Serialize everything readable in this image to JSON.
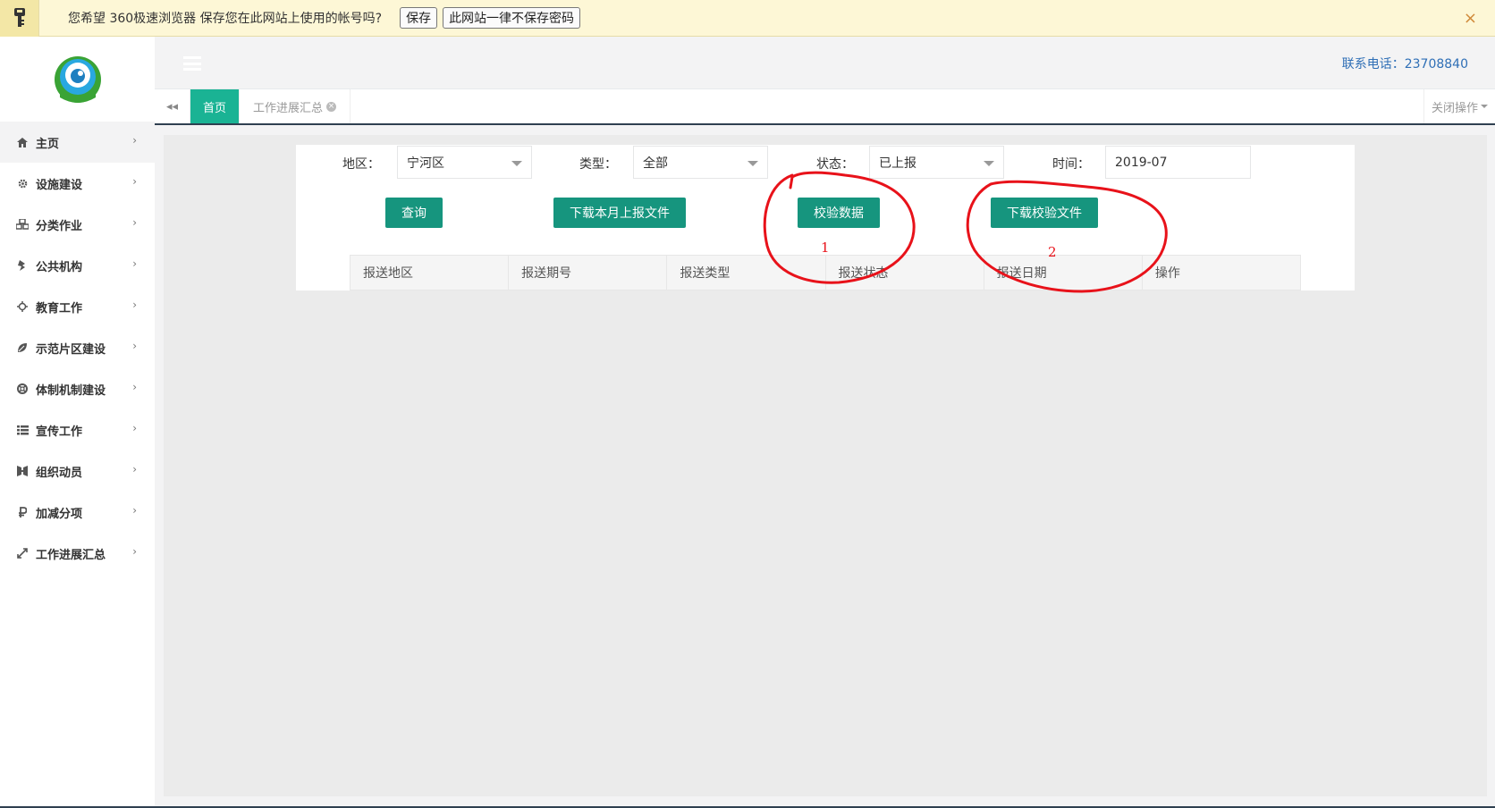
{
  "password_bar": {
    "message": "您希望 360极速浏览器 保存您在此网站上使用的帐号吗?",
    "save_label": "保存",
    "never_label": "此网站一律不保存密码",
    "close_glyph": "×"
  },
  "sidebar": {
    "items": [
      {
        "label": "主页",
        "icon": "home-icon"
      },
      {
        "label": "设施建设",
        "icon": "gear-icon"
      },
      {
        "label": "分类作业",
        "icon": "cubes-icon"
      },
      {
        "label": "公共机构",
        "icon": "ticket-icon"
      },
      {
        "label": "教育工作",
        "icon": "crosshair-icon"
      },
      {
        "label": "示范片区建设",
        "icon": "leaf-icon"
      },
      {
        "label": "体制机制建设",
        "icon": "lifebuoy-icon"
      },
      {
        "label": "宣传工作",
        "icon": "list-icon"
      },
      {
        "label": "组织动员",
        "icon": "organization-icon"
      },
      {
        "label": "加减分项",
        "icon": "ruble-icon"
      },
      {
        "label": "工作进展汇总",
        "icon": "expand-icon"
      }
    ],
    "chevron": "›"
  },
  "header": {
    "contact": "联系电话：23708840"
  },
  "tabs": {
    "back_glyph": "◂◂",
    "items": [
      {
        "label": "首页"
      },
      {
        "label": "工作进展汇总",
        "close": "×"
      }
    ],
    "close_ops_label": "关闭操作"
  },
  "filters": {
    "region_label": "地区：",
    "region_value": "宁河区",
    "type_label": "类型：",
    "type_value": "全部",
    "status_label": "状态：",
    "status_value": "已上报",
    "time_label": "时间：",
    "time_value": "2019-07"
  },
  "buttons": {
    "query": "查询",
    "download_monthly": "下载本月上报文件",
    "verify_data": "校验数据",
    "download_verify": "下载校验文件"
  },
  "table": {
    "columns": [
      "报送地区",
      "报送期号",
      "报送类型",
      "报送状态",
      "报送日期",
      "操作"
    ]
  },
  "annotations": {
    "mark_1": "1",
    "mark_2": "2"
  },
  "colors": {
    "accent": "#16957e",
    "tab_active": "#1ab394",
    "annotation": "#e8121a",
    "contact_link": "#2f6fb6"
  }
}
